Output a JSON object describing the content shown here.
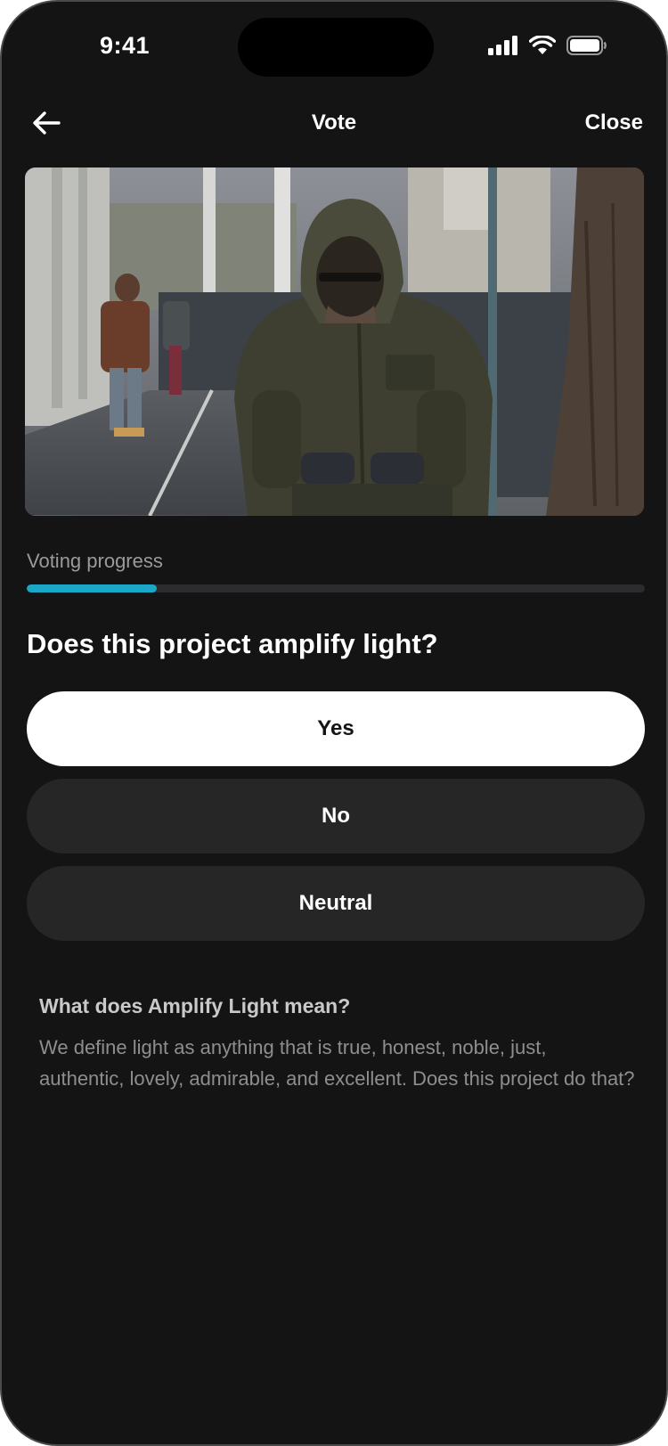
{
  "status_bar": {
    "time": "9:41",
    "icons": [
      "signal-icon",
      "wifi-icon",
      "battery-icon"
    ]
  },
  "nav": {
    "back_icon": "arrow-left-icon",
    "title": "Vote",
    "close_label": "Close"
  },
  "hero": {
    "image": "photo of a person in a hooded jacket on a sidewalk"
  },
  "progress": {
    "label": "Voting progress",
    "fraction": 0.21,
    "color": "#1aa7c8"
  },
  "question": "Does this project amplify light?",
  "options": [
    {
      "label": "Yes",
      "selected": true
    },
    {
      "label": "No",
      "selected": false
    },
    {
      "label": "Neutral",
      "selected": false
    }
  ],
  "info": {
    "title": "What does Amplify Light mean?",
    "body": "We define light as anything that is true, honest, noble, just, authentic, lovely, admirable, and excellent. Does this project do that?"
  }
}
